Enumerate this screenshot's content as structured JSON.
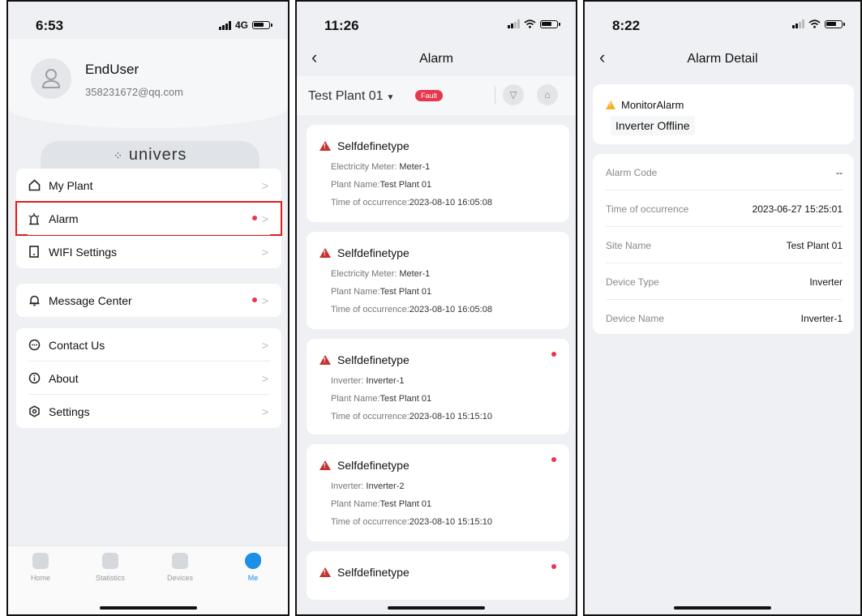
{
  "screen1": {
    "status": {
      "time": "6:53",
      "network": "4G"
    },
    "user": {
      "name": "EndUser",
      "email": "358231672@qq.com"
    },
    "brand": "univers",
    "menu_group1": [
      {
        "label": "My Plant",
        "icon": "home-icon"
      },
      {
        "label": "Alarm",
        "icon": "alarm-icon",
        "badge": true,
        "highlighted": true
      },
      {
        "label": "WIFI Settings",
        "icon": "wifi-device-icon"
      }
    ],
    "menu_group2": [
      {
        "label": "Message Center",
        "icon": "bell-icon",
        "badge": true
      }
    ],
    "menu_group3": [
      {
        "label": "Contact Us",
        "icon": "chat-icon"
      },
      {
        "label": "About",
        "icon": "info-icon"
      },
      {
        "label": "Settings",
        "icon": "settings-icon"
      }
    ],
    "tabs": [
      {
        "label": "Home",
        "active": false
      },
      {
        "label": "Statistics",
        "active": false
      },
      {
        "label": "Devices",
        "active": false
      },
      {
        "label": "Me",
        "active": true
      }
    ]
  },
  "screen2": {
    "status": {
      "time": "11:26"
    },
    "title": "Alarm",
    "plant_select": "Test Plant 01",
    "fault_badge": "Fault",
    "alarms": [
      {
        "title": "Selfdefinetype",
        "device_label": "Electricity Meter: ",
        "device_value": "Meter-1",
        "plant_label": "Plant Name:",
        "plant_value": "Test Plant 01",
        "time_label": "Time of occurrence:",
        "time_value": "2023-08-10 16:05:08",
        "unread": false
      },
      {
        "title": "Selfdefinetype",
        "device_label": "Electricity Meter: ",
        "device_value": "Meter-1",
        "plant_label": "Plant Name:",
        "plant_value": "Test Plant 01",
        "time_label": "Time of occurrence:",
        "time_value": "2023-08-10 16:05:08",
        "unread": false
      },
      {
        "title": "Selfdefinetype",
        "device_label": "Inverter: ",
        "device_value": "Inverter-1",
        "plant_label": "Plant Name:",
        "plant_value": "Test Plant 01",
        "time_label": "Time of occurrence:",
        "time_value": "2023-08-10 15:15:10",
        "unread": true
      },
      {
        "title": "Selfdefinetype",
        "device_label": "Inverter: ",
        "device_value": "Inverter-2",
        "plant_label": "Plant Name:",
        "plant_value": "Test Plant 01",
        "time_label": "Time of occurrence:",
        "time_value": "2023-08-10 15:15:10",
        "unread": true
      },
      {
        "title": "Selfdefinetype",
        "unread": true
      }
    ]
  },
  "screen3": {
    "status": {
      "time": "8:22"
    },
    "title": "Alarm Detail",
    "alarm_name": "MonitorAlarm",
    "alarm_sub": "Inverter Offline",
    "details": [
      {
        "key": "Alarm Code",
        "value": "--"
      },
      {
        "key": "Time of occurrence",
        "value": "2023-06-27 15:25:01"
      },
      {
        "key": "Site Name",
        "value": "Test Plant 01"
      },
      {
        "key": "Device Type",
        "value": "Inverter"
      },
      {
        "key": "Device Name",
        "value": "Inverter-1"
      }
    ]
  },
  "colors": {
    "accent": "#1c8fe8",
    "alert": "#e8364b",
    "highlight": "#e21b1b",
    "warn_red": "#c6322e",
    "warn_yellow": "#f5b324"
  }
}
